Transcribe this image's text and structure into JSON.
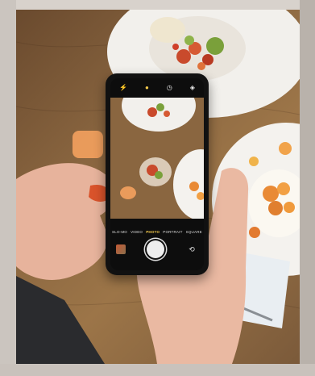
{
  "photo": {
    "subject": "",
    "camera_modes": [
      "SLO-MO",
      "VIDEO",
      "PHOTO",
      "PORTRAIT",
      "SQUARE"
    ],
    "active_mode": "PHOTO"
  },
  "colors": {
    "table_wood": "#8a6640",
    "plate_white": "#f2f0ec",
    "skin": "#e8b7a0",
    "nail_polish": "#d0532a",
    "phone_body": "#111111",
    "active_mode_yellow": "#f2c94c"
  },
  "icons": {
    "flash": "flash-icon",
    "live": "live-photo-icon",
    "timer": "timer-icon",
    "filters": "filters-icon",
    "flip": "camera-flip-icon"
  }
}
